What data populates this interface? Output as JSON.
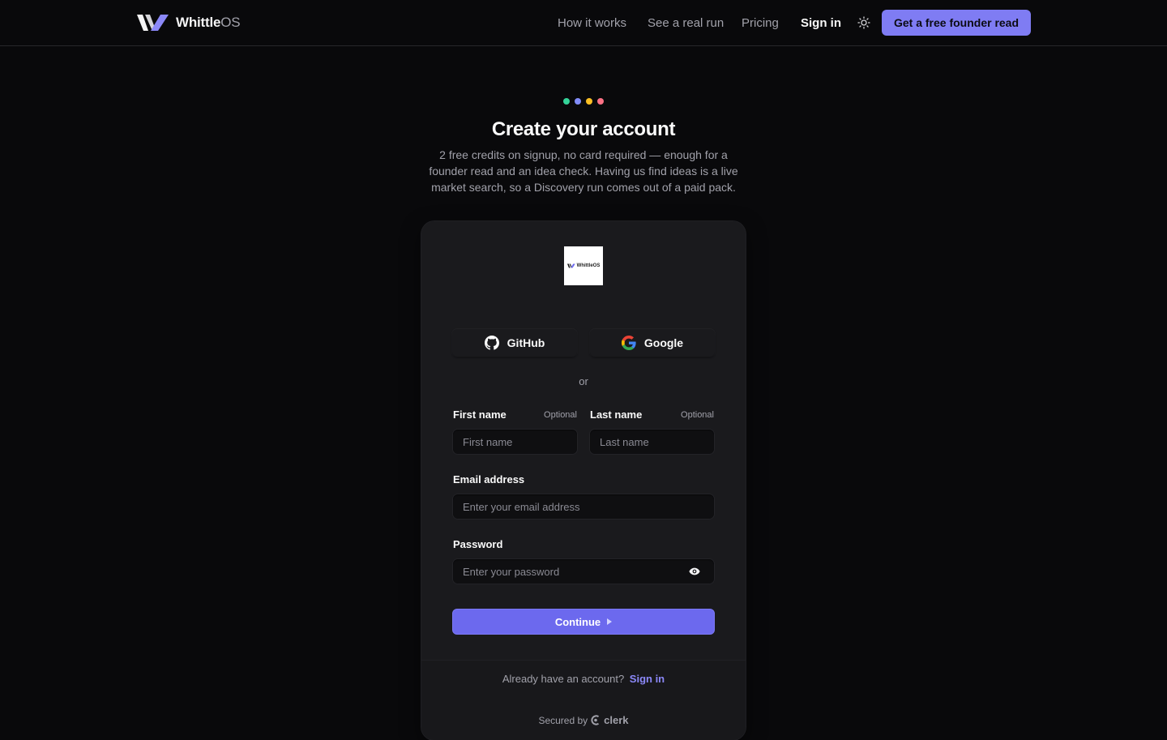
{
  "header": {
    "brand_name": "Whittle",
    "brand_suffix": "OS",
    "nav": [
      {
        "label": "How it works"
      },
      {
        "label": "See a real run"
      },
      {
        "label": "Pricing"
      },
      {
        "label": "Sign in"
      }
    ],
    "theme_icon": "sun-icon",
    "cta_label": "Get a free founder read"
  },
  "hero": {
    "dot_colors": [
      "#34d399",
      "#818cf8",
      "#fbbf24",
      "#fb7185"
    ],
    "title": "Create your account",
    "subtitle": "2 free credits on signup, no card required — enough for a founder read and an idea check. Having us find ideas is a live market search, so a Discovery run comes out of a paid pack."
  },
  "signup": {
    "logo_text": "WhittleOS",
    "social": [
      {
        "label": "GitHub",
        "icon": "github-icon"
      },
      {
        "label": "Google",
        "icon": "google-icon"
      }
    ],
    "divider": "or",
    "first_name": {
      "label": "First name",
      "optional": "Optional",
      "placeholder": "First name"
    },
    "last_name": {
      "label": "Last name",
      "optional": "Optional",
      "placeholder": "Last name"
    },
    "email": {
      "label": "Email address",
      "placeholder": "Enter your email address"
    },
    "password": {
      "label": "Password",
      "placeholder": "Enter your password"
    },
    "continue_label": "Continue",
    "have_account": "Already have an account?",
    "sign_in_link": "Sign in",
    "secured_by": "Secured by",
    "secured_brand": "clerk"
  },
  "colors": {
    "accent": "#7f7cf3",
    "primary_button": "#6c69ee",
    "background": "#09090b",
    "card": "#1a1a1d"
  }
}
